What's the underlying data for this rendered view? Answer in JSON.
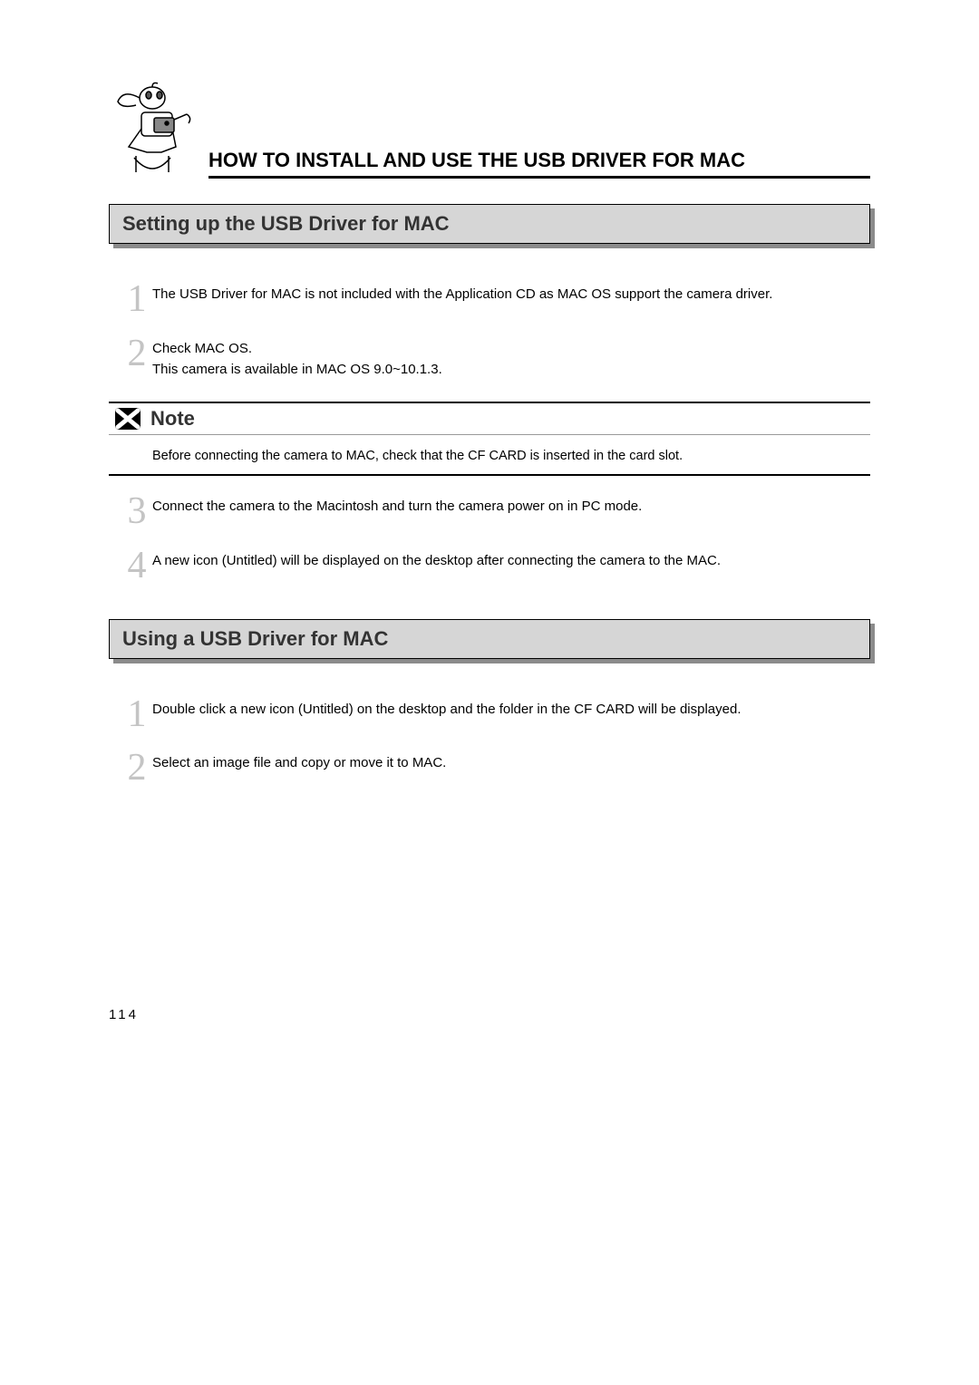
{
  "mainTitle": "HOW TO INSTALL AND USE THE USB DRIVER FOR MAC",
  "sections": {
    "setup": {
      "title": "Setting up the USB Driver for MAC",
      "steps": {
        "s1": {
          "num": "1",
          "text": "The USB Driver for MAC is not included with the Application CD as MAC OS support the camera driver."
        },
        "s2": {
          "num": "2",
          "text_line1": "Check MAC OS.",
          "text_line2": "This camera is available in MAC OS 9.0~10.1.3."
        },
        "s3": {
          "num": "3",
          "text": "Connect the camera to the Macintosh and turn the camera power on in PC mode."
        },
        "s4": {
          "num": "4",
          "text": "A new icon (Untitled) will be displayed on the desktop after connecting the camera to the MAC."
        }
      }
    },
    "using": {
      "title": "Using a USB Driver for MAC",
      "steps": {
        "u1": {
          "num": "1",
          "text": "Double click a new icon (Untitled) on the desktop and the folder in the CF CARD will be displayed."
        },
        "u2": {
          "num": "2",
          "text": "Select an image file and copy or move it to MAC."
        }
      }
    }
  },
  "note": {
    "label": "Note",
    "body": "Before connecting the camera to MAC, check that the CF CARD is inserted in the card slot."
  },
  "pageNumber": "114"
}
